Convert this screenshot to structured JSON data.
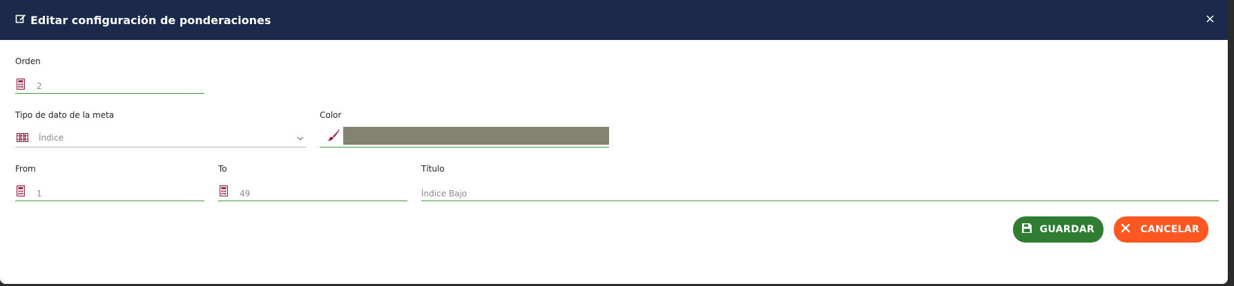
{
  "modal": {
    "title": "Editar configuración de ponderaciones",
    "close_label": "×"
  },
  "form": {
    "orden": {
      "label": "Orden",
      "value": "2"
    },
    "tipo_dato": {
      "label": "Tipo de dato de la meta",
      "value": "Índice"
    },
    "color": {
      "label": "Color",
      "value_hex": "#848372"
    },
    "from": {
      "label": "From",
      "value": "1"
    },
    "to": {
      "label": "To",
      "value": "49"
    },
    "titulo": {
      "label": "Título",
      "value": "Índice Bajo"
    }
  },
  "actions": {
    "save_label": "GUARDAR",
    "cancel_label": "CANCELAR"
  },
  "colors": {
    "header_bg": "#1b2a4a",
    "accent_green": "#3c9a3c",
    "icon_maroon": "#8b1c3a",
    "save_bg": "#2e7d32",
    "cancel_bg": "#ff5722"
  },
  "icons": [
    "edit-icon",
    "close-icon",
    "calculator-icon",
    "book-icon",
    "chevron-down-icon",
    "brush-icon",
    "floppy-icon"
  ]
}
